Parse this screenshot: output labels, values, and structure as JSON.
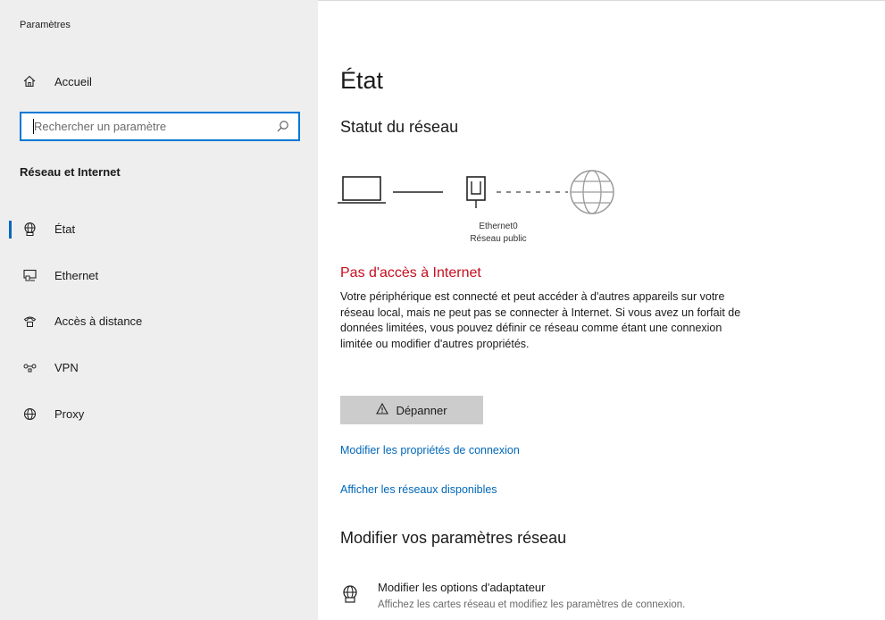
{
  "window": {
    "title": "Paramètres"
  },
  "sidebar": {
    "home_label": "Accueil",
    "search": {
      "placeholder": "Rechercher un paramètre",
      "value": ""
    },
    "section_title": "Réseau et Internet",
    "items": [
      {
        "label": "État",
        "icon": "globe-network-icon",
        "active": true
      },
      {
        "label": "Ethernet",
        "icon": "ethernet-monitor-icon",
        "active": false
      },
      {
        "label": "Accès à distance",
        "icon": "dialup-phone-icon",
        "active": false
      },
      {
        "label": "VPN",
        "icon": "vpn-icon",
        "active": false
      },
      {
        "label": "Proxy",
        "icon": "globe-icon",
        "active": false
      }
    ]
  },
  "main": {
    "title": "État",
    "network_status_title": "Statut du réseau",
    "diagram": {
      "device_name": "Ethernet0",
      "network_type": "Réseau public"
    },
    "alert_title": "Pas d'accès à Internet",
    "alert_description": "Votre périphérique est connecté et peut accéder à d'autres appareils sur votre réseau local, mais ne peut pas se connecter à Internet. Si vous avez un forfait de données limitées, vous pouvez définir ce réseau comme étant une connexion limitée ou modifier d'autres propriétés.",
    "troubleshoot_label": "Dépanner",
    "link_connection_properties": "Modifier les propriétés de connexion",
    "link_available_networks": "Afficher les réseaux disponibles",
    "change_settings_title": "Modifier vos paramètres réseau",
    "adapter_options": {
      "title": "Modifier les options d'adaptateur",
      "description": "Affichez les cartes réseau et modifiez les paramètres de connexion."
    }
  },
  "colors": {
    "accent": "#0067c0",
    "link": "#0067b8",
    "error": "#c50f1f",
    "sidebar_bg": "#eeeeee"
  }
}
